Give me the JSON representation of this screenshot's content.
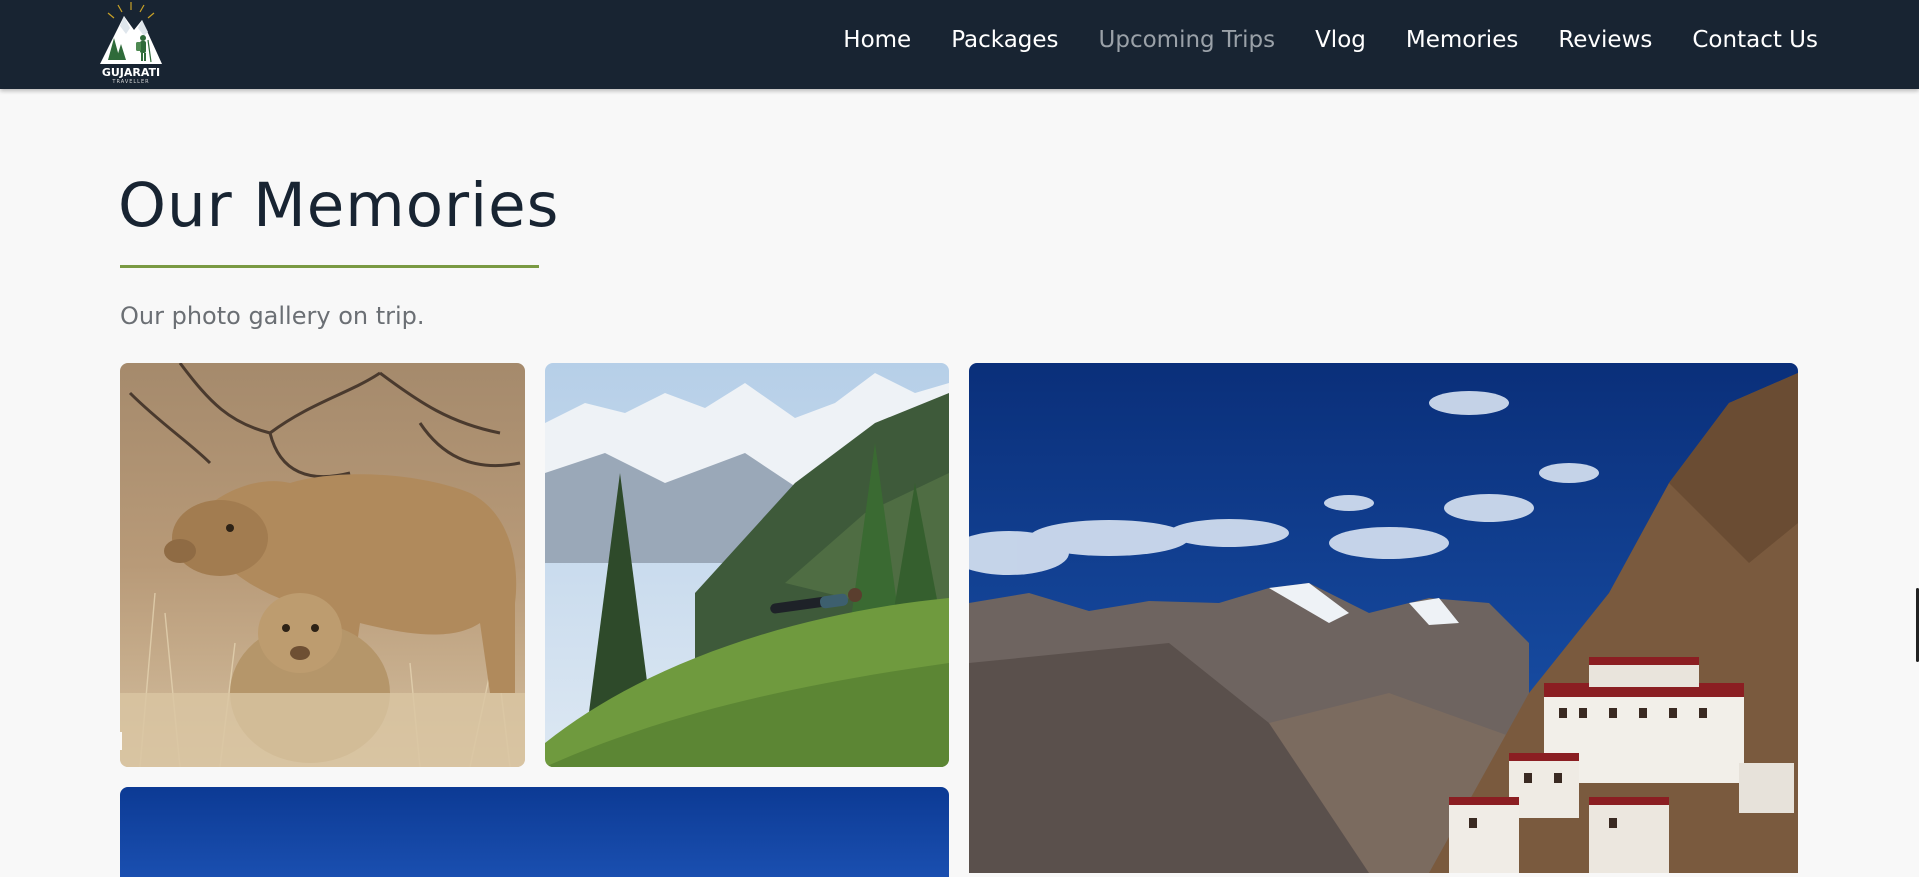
{
  "brand": {
    "logo_line1": "the",
    "logo_line2": "GUJARATI",
    "logo_line3": "TRAVELLER"
  },
  "nav": {
    "home": "Home",
    "packages": "Packages",
    "upcoming": "Upcoming Trips",
    "vlog": "Vlog",
    "memories": "Memories",
    "reviews": "Reviews",
    "contact": "Contact Us"
  },
  "section": {
    "title": "Our Memories",
    "subtitle": "Our photo gallery on trip."
  },
  "colors": {
    "header_bg": "#182432",
    "accent": "#7a9a43",
    "title": "#182432",
    "muted_nav": "#9aa1a8"
  },
  "gallery": [
    {
      "subject": "lions-in-grassland"
    },
    {
      "subject": "mountain-meadow-with-resting-hiker"
    },
    {
      "subject": "himalayan-monastery-on-cliff"
    },
    {
      "subject": "blue-sky"
    }
  ]
}
